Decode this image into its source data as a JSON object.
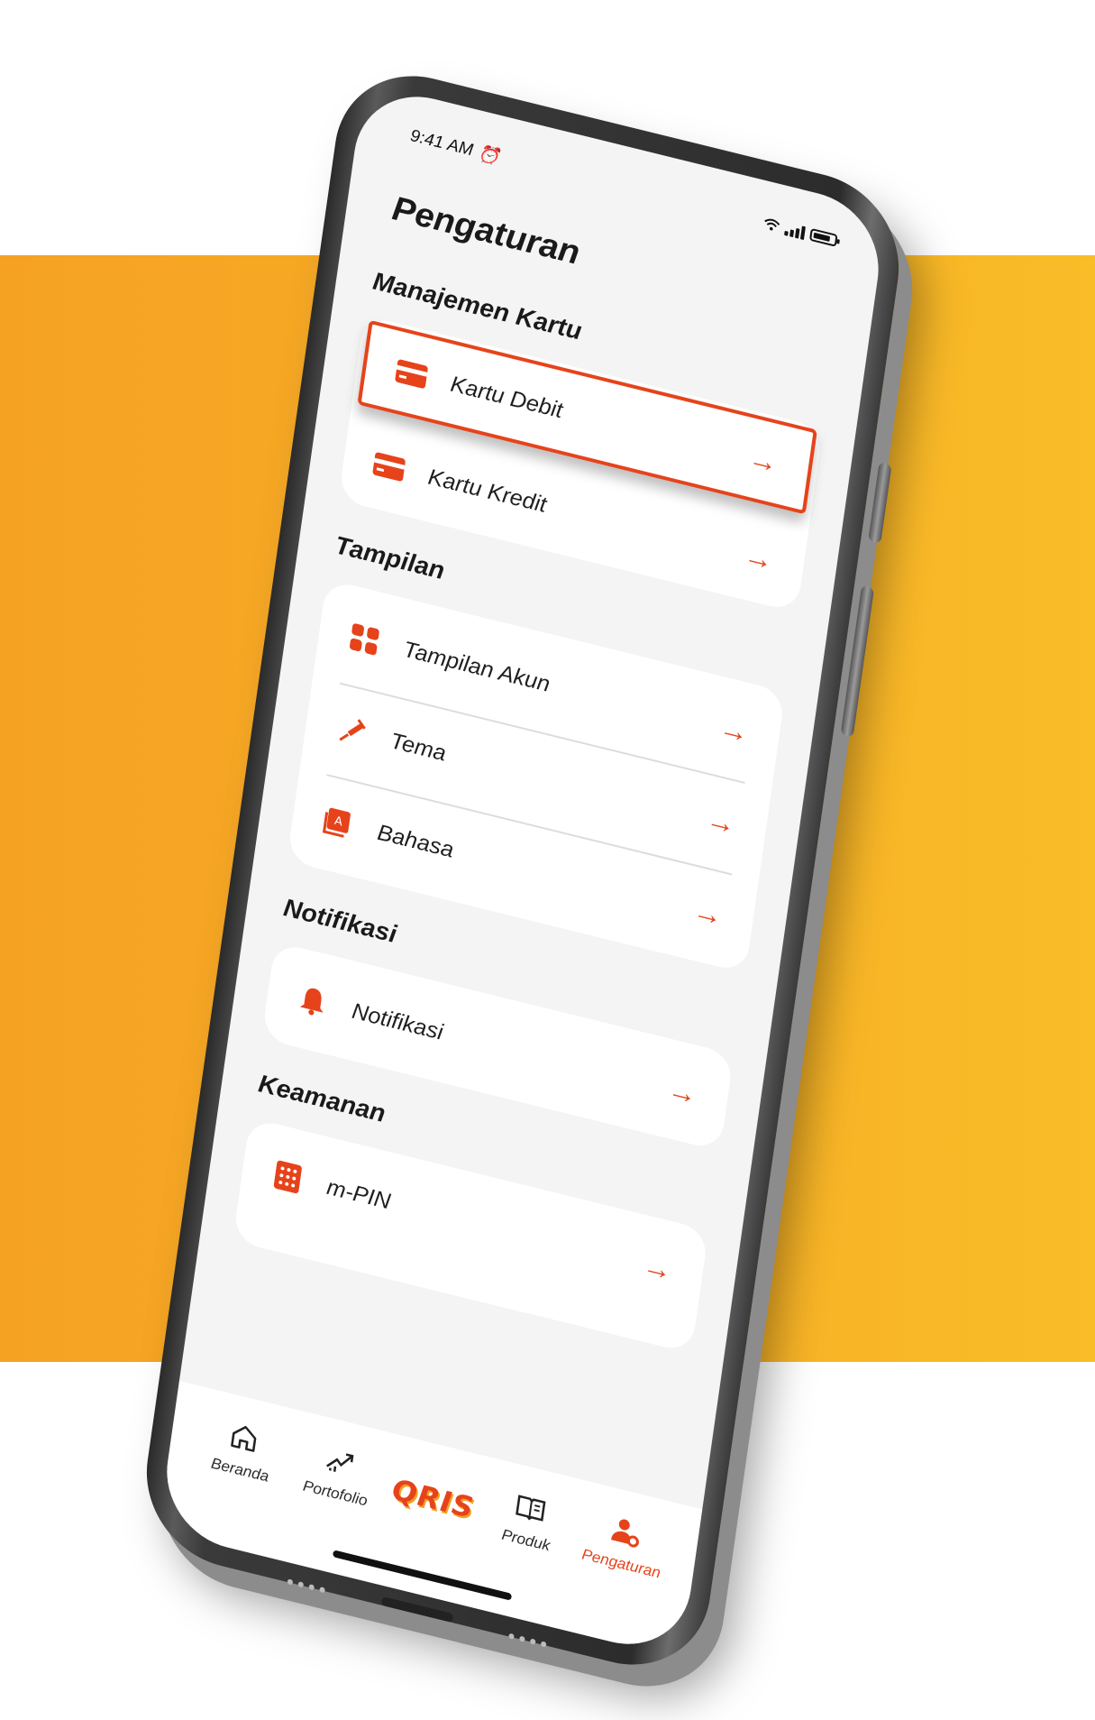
{
  "status_bar": {
    "time": "9:41 AM"
  },
  "page": {
    "title": "Pengaturan"
  },
  "sections": [
    {
      "title": "Manajemen Kartu",
      "items": [
        {
          "label": "Kartu Debit",
          "icon": "card-icon",
          "highlighted": true
        },
        {
          "label": "Kartu Kredit",
          "icon": "card-icon"
        }
      ]
    },
    {
      "title": "Tampilan",
      "items": [
        {
          "label": "Tampilan Akun",
          "icon": "grid-icon"
        },
        {
          "label": "Tema",
          "icon": "brush-icon"
        },
        {
          "label": "Bahasa",
          "icon": "language-icon"
        }
      ]
    },
    {
      "title": "Notifikasi",
      "items": [
        {
          "label": "Notifikasi",
          "icon": "bell-icon"
        }
      ]
    },
    {
      "title": "Keamanan",
      "items": [
        {
          "label": "m-PIN",
          "icon": "keypad-icon"
        }
      ]
    }
  ],
  "tabbar": {
    "items": [
      {
        "label": "Beranda",
        "icon": "home-icon"
      },
      {
        "label": "Portofolio",
        "icon": "growth-chart-icon"
      },
      {
        "label": "QRIS",
        "icon": "qris-logo"
      },
      {
        "label": "Produk",
        "icon": "book-icon"
      },
      {
        "label": "Pengaturan",
        "icon": "user-settings-icon",
        "active": true
      }
    ]
  },
  "colors": {
    "accent": "#E6431B",
    "background_band": "#F5A223",
    "screen_bg": "#F4F4F4"
  }
}
